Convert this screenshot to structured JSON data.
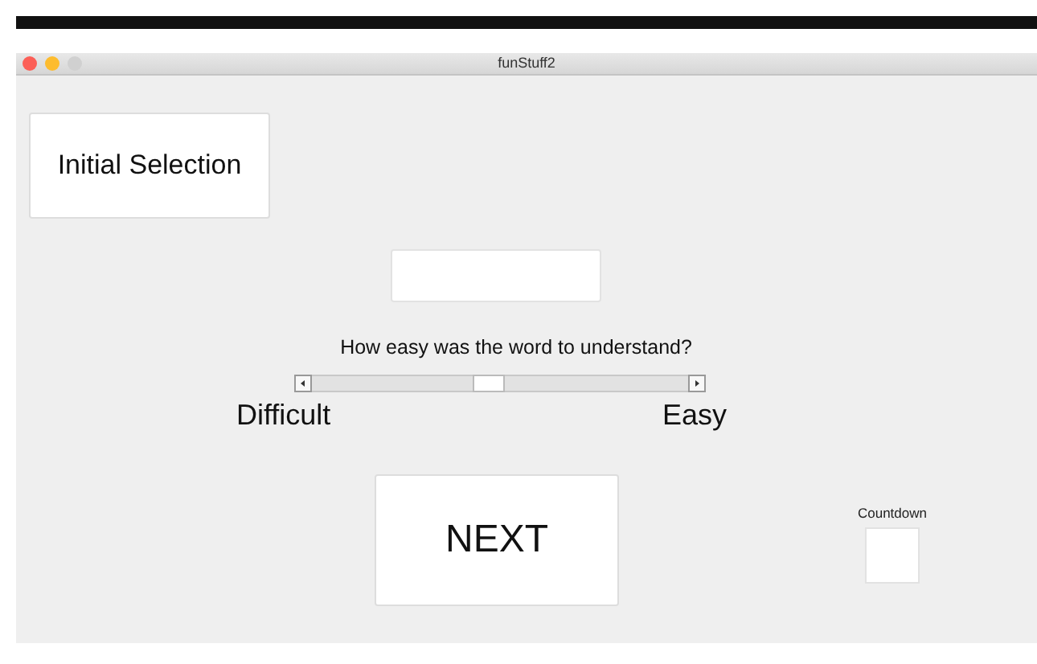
{
  "window": {
    "title": "funStuff2"
  },
  "initial_selection_button": {
    "label": "Initial Selection"
  },
  "question": "How easy was the word to understand?",
  "slider": {
    "level": 0.47,
    "min_label": "Difficult",
    "max_label": "Easy"
  },
  "next_button": {
    "label": "NEXT"
  },
  "countdown": {
    "label": "Countdown"
  }
}
